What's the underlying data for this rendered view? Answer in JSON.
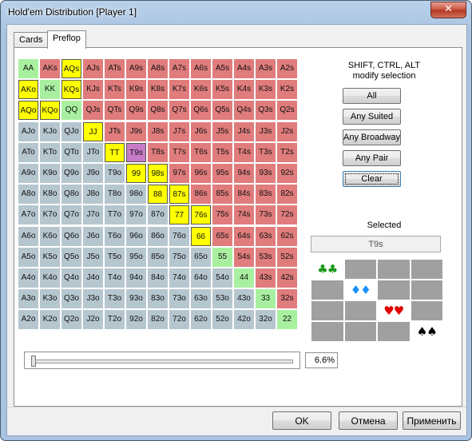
{
  "window": {
    "title": "Hold'em Distribution [Player 1]",
    "close_glyph": "✕"
  },
  "tabs": [
    {
      "label": "Cards"
    },
    {
      "label": "Preflop"
    }
  ],
  "grid": {
    "rows": [
      [
        "AA",
        "AKs",
        "AQs",
        "AJs",
        "ATs",
        "A9s",
        "A8s",
        "A7s",
        "A6s",
        "A5s",
        "A4s",
        "A3s",
        "A2s"
      ],
      [
        "AKo",
        "KK",
        "KQs",
        "KJs",
        "KTs",
        "K9s",
        "K8s",
        "K7s",
        "K6s",
        "K5s",
        "K4s",
        "K3s",
        "K2s"
      ],
      [
        "AQo",
        "KQo",
        "QQ",
        "QJs",
        "QTs",
        "Q9s",
        "Q8s",
        "Q7s",
        "Q6s",
        "Q5s",
        "Q4s",
        "Q3s",
        "Q2s"
      ],
      [
        "AJo",
        "KJo",
        "QJo",
        "JJ",
        "JTs",
        "J9s",
        "J8s",
        "J7s",
        "J6s",
        "J5s",
        "J4s",
        "J3s",
        "J2s"
      ],
      [
        "ATo",
        "KTo",
        "QTo",
        "JTo",
        "TT",
        "T9s",
        "T8s",
        "T7s",
        "T6s",
        "T5s",
        "T4s",
        "T3s",
        "T2s"
      ],
      [
        "A9o",
        "K9o",
        "Q9o",
        "J9o",
        "T9o",
        "99",
        "98s",
        "97s",
        "96s",
        "95s",
        "94s",
        "93s",
        "92s"
      ],
      [
        "A8o",
        "K8o",
        "Q8o",
        "J8o",
        "T8o",
        "98o",
        "88",
        "87s",
        "86s",
        "85s",
        "84s",
        "83s",
        "82s"
      ],
      [
        "A7o",
        "K7o",
        "Q7o",
        "J7o",
        "T7o",
        "97o",
        "87o",
        "77",
        "76s",
        "75s",
        "74s",
        "73s",
        "72s"
      ],
      [
        "A6o",
        "K6o",
        "Q6o",
        "J6o",
        "T6o",
        "96o",
        "86o",
        "76o",
        "66",
        "65s",
        "64s",
        "63s",
        "62s"
      ],
      [
        "A5o",
        "K5o",
        "Q5o",
        "J5o",
        "T5o",
        "95o",
        "85o",
        "75o",
        "65o",
        "55",
        "54s",
        "53s",
        "52s"
      ],
      [
        "A4o",
        "K4o",
        "Q4o",
        "J4o",
        "T4o",
        "94o",
        "84o",
        "74o",
        "64o",
        "54o",
        "44",
        "43s",
        "42s"
      ],
      [
        "A3o",
        "K3o",
        "Q3o",
        "J3o",
        "T3o",
        "93o",
        "83o",
        "73o",
        "63o",
        "53o",
        "43o",
        "33",
        "32s"
      ],
      [
        "A2o",
        "K2o",
        "Q2o",
        "J2o",
        "T2o",
        "92o",
        "82o",
        "72o",
        "62o",
        "52o",
        "42o",
        "32o",
        "22"
      ]
    ],
    "selected": [
      "AQs",
      "AKo",
      "KQs",
      "AQo",
      "KQo",
      "JJ",
      "TT",
      "99",
      "98s",
      "88",
      "87s",
      "77",
      "76s",
      "66"
    ],
    "current": "T9s",
    "colors": {
      "suited": "#e07c7c",
      "offsuit": "#b6c6cf",
      "pair": "#a8f0a0",
      "selected": "#ffff00",
      "current": "#c87cc8"
    }
  },
  "hint": {
    "line1": "SHIFT, CTRL, ALT",
    "line2": "modify selection"
  },
  "buttons": {
    "all": "All",
    "any_suited": "Any Suited",
    "any_broadway": "Any Broadway",
    "any_pair": "Any Pair",
    "clear": "Clear"
  },
  "selected_section": {
    "label": "Selected",
    "value": "T9s"
  },
  "suit_grid": {
    "cells": [
      {
        "glyph": "♣♣",
        "color": "#1a9a1a",
        "on": true
      },
      {
        "glyph": "",
        "on": false
      },
      {
        "glyph": "",
        "on": false
      },
      {
        "glyph": "",
        "on": false
      },
      {
        "glyph": "",
        "on": false
      },
      {
        "glyph": "♦♦",
        "color": "#1e90ff",
        "on": true
      },
      {
        "glyph": "",
        "on": false
      },
      {
        "glyph": "",
        "on": false
      },
      {
        "glyph": "",
        "on": false
      },
      {
        "glyph": "",
        "on": false
      },
      {
        "glyph": "♥♥",
        "color": "#e00000",
        "on": true
      },
      {
        "glyph": "",
        "on": false
      },
      {
        "glyph": "",
        "on": false
      },
      {
        "glyph": "",
        "on": false
      },
      {
        "glyph": "",
        "on": false
      },
      {
        "glyph": "♠♠",
        "color": "#000000",
        "on": true
      }
    ]
  },
  "slider": {
    "value_pct": 6.6,
    "value_text": "6.6%"
  },
  "footer": {
    "ok": "OK",
    "cancel": "Отмена",
    "apply": "Применить"
  }
}
